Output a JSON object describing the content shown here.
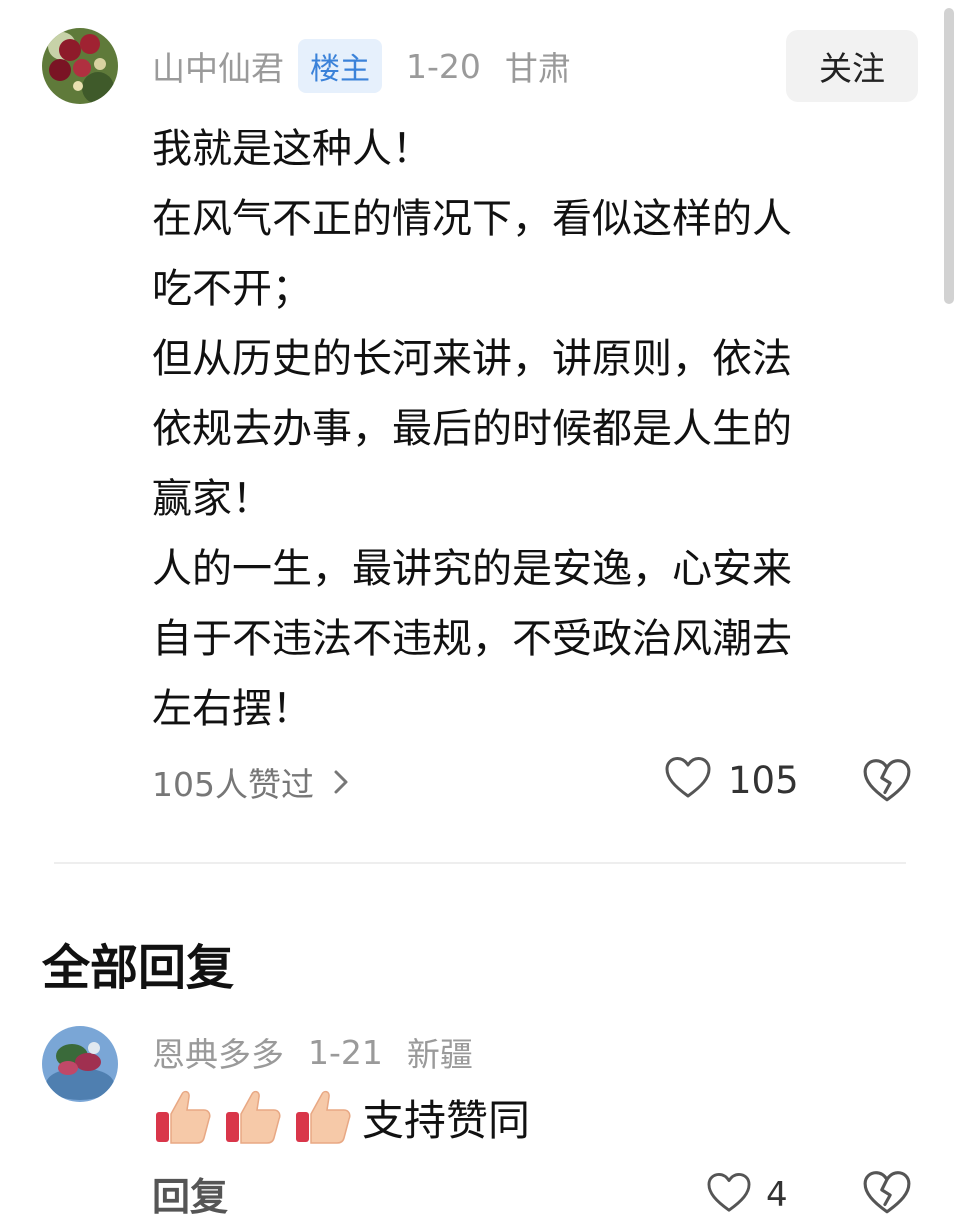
{
  "post": {
    "author": "山中仙君",
    "badge": "楼主",
    "date": "1-20",
    "location": "甘肃",
    "follow_label": "关注",
    "lines": [
      "我就是这种人！",
      "在风气不正的情况下，看似这样的人",
      "吃不开；",
      "但从历史的长河来讲，讲原则，依法",
      "依规去办事，最后的时候都是人生的",
      "赢家！",
      "人的一生，最讲究的是安逸，心安来",
      "自于不违法不违规，不受政治风潮去",
      "左右摆！"
    ],
    "likers_label": "105人赞过",
    "like_count": "105",
    "colors": {
      "badge_bg": "#e6f0fc",
      "badge_text": "#3b82d9"
    }
  },
  "replies_section": {
    "title": "全部回复"
  },
  "reply": {
    "author": "恩典多多",
    "date": "1-21",
    "location": "新疆",
    "emojis": [
      "thumbs-up-icon",
      "thumbs-up-icon",
      "thumbs-up-icon"
    ],
    "text": "支持赞同",
    "action_label": "回复",
    "like_count": "4"
  }
}
